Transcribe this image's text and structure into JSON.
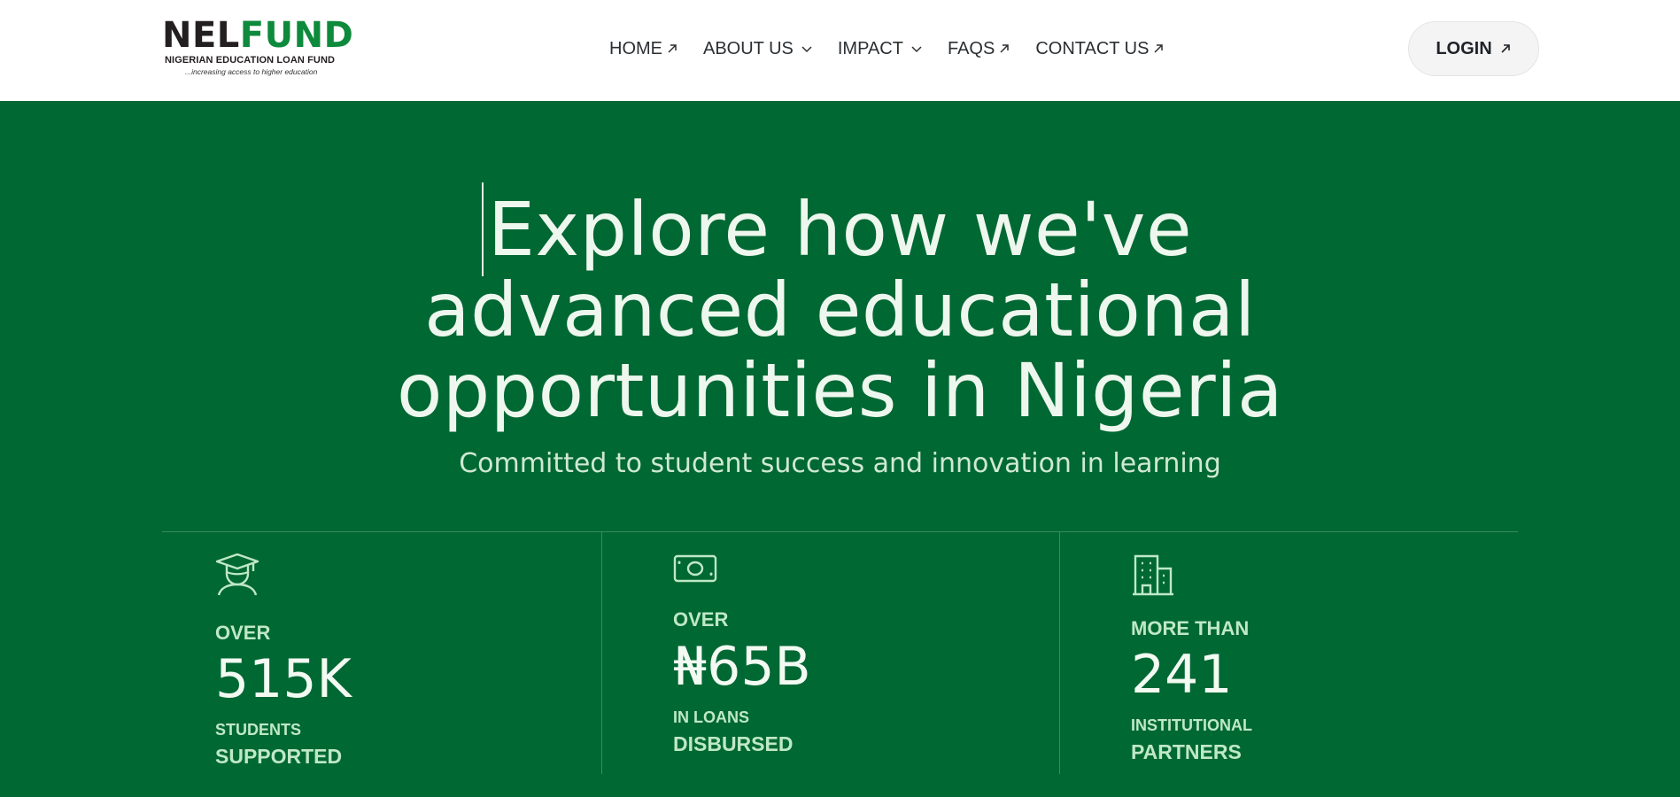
{
  "logo": {
    "word_nel": "NEL",
    "word_fund": "FUND",
    "subtitle": "NIGERIAN EDUCATION LOAN FUND",
    "tagline": "...increasing access to higher education"
  },
  "nav": {
    "items": [
      {
        "label": "HOME",
        "icon": "arrow-up-right-icon"
      },
      {
        "label": "ABOUT US",
        "icon": "chevron-down-icon"
      },
      {
        "label": "IMPACT",
        "icon": "chevron-down-icon"
      },
      {
        "label": "FAQS",
        "icon": "arrow-up-right-icon"
      },
      {
        "label": "CONTACT US",
        "icon": "arrow-up-right-icon"
      }
    ],
    "login_label": "LOGIN"
  },
  "hero": {
    "title_line1": "Explore how we've",
    "title_line2": "advanced educational",
    "title_line3": "opportunities in Nigeria",
    "subtitle": "Committed to student success and innovation in learning"
  },
  "stats": [
    {
      "icon": "graduate-student-icon",
      "prefix": "OVER",
      "value": "515K",
      "line1": "STUDENTS",
      "line2": "SUPPORTED"
    },
    {
      "icon": "money-bill-icon",
      "prefix": "OVER",
      "value": "₦65B",
      "line1": "IN LOANS",
      "line2": "DISBURSED"
    },
    {
      "icon": "building-icon",
      "prefix": "MORE THAN",
      "value": "241",
      "line1": "INSTITUTIONAL",
      "line2": "PARTNERS"
    }
  ],
  "colors": {
    "brand_green": "#006833",
    "logo_green": "#0d8a3c",
    "logo_dark": "#231f20",
    "hero_text": "#eef7ee",
    "stat_label": "#bfe8c7"
  }
}
